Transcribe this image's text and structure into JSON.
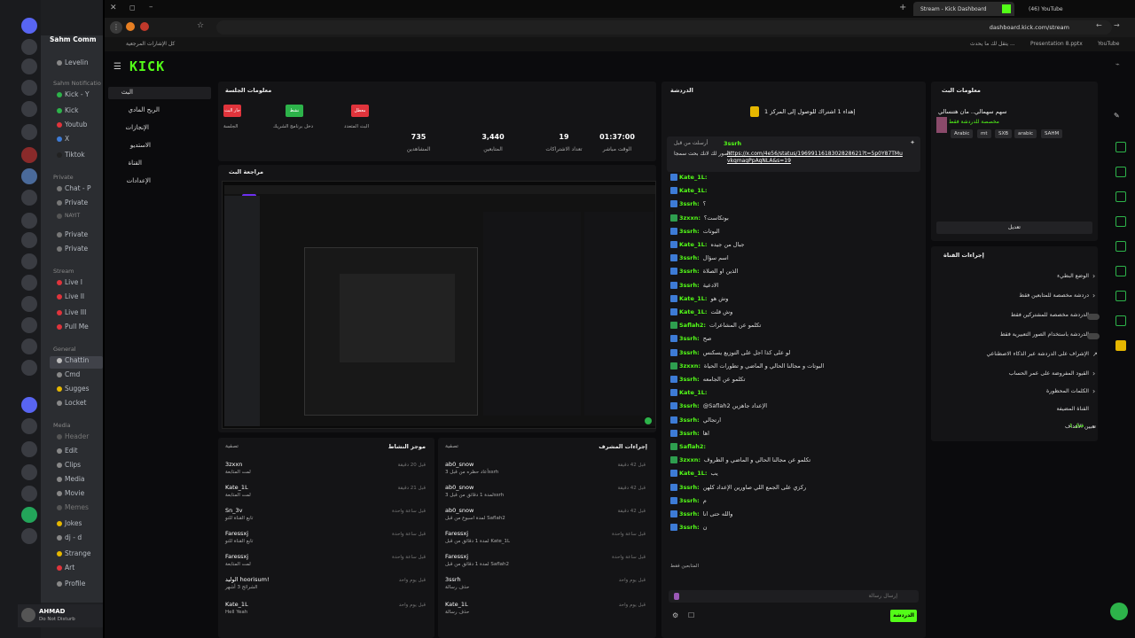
{
  "discord": {
    "server_name": "Sahm Comm",
    "groups": [
      {
        "label": "Sahm Notificatio"
      },
      {
        "label": "Private"
      },
      {
        "label": "Stream"
      },
      {
        "label": "General"
      },
      {
        "label": "Media"
      }
    ],
    "channels": [
      "Levelin",
      "Kick - Y",
      "Kick",
      "Youtub",
      "X",
      "Tiktok",
      "Chat - P",
      "Private",
      "NAYIT",
      "Private",
      "Private",
      "Live I",
      "Live II",
      "Live III",
      "Pull Me",
      "Chattin",
      "Cmd",
      "Sugges",
      "Locket",
      "Header",
      "Edit",
      "Clips",
      "Media",
      "Movie",
      "Memes",
      "Jokes",
      "dj - d",
      "Strange",
      "Art",
      "Profile"
    ],
    "user": {
      "name": "AHMAD",
      "status": "Do Not Disturb"
    }
  },
  "browser": {
    "tabs": [
      {
        "label": "Stream - Kick Dashboard"
      },
      {
        "label": "(46) YouTube"
      }
    ],
    "url": "dashboard.kick.com/stream",
    "bookmarks_left": "كل الإشارات المرجعية",
    "bookmarks_right": [
      "يتقل لك ما يحدث ...",
      "Presentation 8.pptx",
      "YouTube"
    ]
  },
  "kick": {
    "logo": "KICK",
    "nav": [
      "البث",
      "الربح المادي",
      "الإنجازات",
      "الاستديو",
      "القناة",
      "الإعدادات"
    ],
    "session": {
      "title": "معلومات الجلسة",
      "stats": [
        {
          "value": "01:37:00",
          "label": "الوقت مباشر"
        },
        {
          "value": "19",
          "label": "تعداد الاشتراكات"
        },
        {
          "value": "3,440",
          "label": "المتابعين"
        },
        {
          "value": "735",
          "label": "المشاهدين"
        }
      ],
      "badges": [
        {
          "label": "البث المتعدد",
          "text": "معطل",
          "color": "#e0343c"
        },
        {
          "label": "دخل برنامج الشريك",
          "text": "نشط",
          "color": "#2db34a"
        },
        {
          "label": "الجلسة",
          "text": "جار البث",
          "color": "#e0343c"
        }
      ]
    },
    "preview": {
      "title": "مراجعة البث"
    },
    "activity": {
      "title": "موجز النشاط",
      "filter": "تصفية",
      "items": [
        {
          "name": "3zxxn",
          "sub": "لمت المتابعة",
          "time": "قبل 20 دقيقة"
        },
        {
          "name": "Kate_1L",
          "sub": "لمت المتابعة",
          "time": "قبل 21 دقيقة"
        },
        {
          "name": "Sn_3v",
          "sub": "تابع القناة للتو",
          "time": "قبل ساعة واحدة"
        },
        {
          "name": "Faressxj",
          "sub": "تابع القناة للتو",
          "time": "قبل ساعة واحدة"
        },
        {
          "name": "Faressxj",
          "sub": "لمت المتابعة",
          "time": "قبل ساعة واحدة"
        },
        {
          "name": "الوليد hoorisum!",
          "sub": "الشرائح 3 أشهر",
          "time": "قبل يوم واحد"
        },
        {
          "name": "Kate_1L",
          "sub": "Hell Yeah",
          "time": "قبل يوم واحد"
        }
      ]
    },
    "mod": {
      "title": "إجراءات المشرف",
      "filter": "تصفية",
      "items": [
        {
          "name": "ab0_snow",
          "sub": "أعاد حظره من قبل 3ssrh",
          "time": "قبل 42 دقيقة"
        },
        {
          "name": "ab0_snow",
          "sub": "لمدة 1 دقائق من قبل 3ssrh",
          "time": "قبل 42 دقيقة"
        },
        {
          "name": "ab0_snow",
          "sub": "لمدة اسبوع من قبل Saflah2",
          "time": "قبل 42 دقيقة"
        },
        {
          "name": "Faressxj",
          "sub": "لمدة 1 دقائق من قبل Kate_1L",
          "time": "قبل ساعة واحدة"
        },
        {
          "name": "Faressxj",
          "sub": "لمدة 1 دقائق من قبل Saflah2",
          "time": "قبل ساعة واحدة"
        },
        {
          "name": "3ssrh",
          "sub": "حذف رسالة",
          "time": "قبل يوم واحد"
        },
        {
          "name": "Kate_1L",
          "sub": "حذف رسالة",
          "time": "قبل يوم واحد"
        }
      ]
    },
    "chat": {
      "title": "الدردشة",
      "top_banner": "إهداء 1 اشتراك للوصول إلى المركز 1",
      "pinned_user": "3ssrh",
      "pinned_label": "أرسلت من قبل",
      "pinned_text": "اصور لك لانك بحت سمجا",
      "pinned_link": "https://x.com/4e56/status/1969911618302828621?t=5p0Y87TMuvkqmagPpAqNLA&s=19",
      "messages": [
        {
          "user": "Kate_1L:",
          "text": "",
          "tone": "b"
        },
        {
          "user": "Kate_1L:",
          "text": "",
          "tone": "b"
        },
        {
          "user": "3ssrh:",
          "text": "؟",
          "tone": "b"
        },
        {
          "user": "3zxxn:",
          "text": "بوتكاست؟",
          "tone": "g"
        },
        {
          "user": "3ssrh:",
          "text": "البوتات",
          "tone": "b"
        },
        {
          "user": "Kate_1L:",
          "text": "جبال من جيده",
          "tone": "b"
        },
        {
          "user": "3ssrh:",
          "text": "اسم سؤال",
          "tone": "b"
        },
        {
          "user": "3ssrh:",
          "text": "الذين او الصلاة",
          "tone": "b"
        },
        {
          "user": "3ssrh:",
          "text": "الادعية",
          "tone": "b"
        },
        {
          "user": "Kate_1L:",
          "text": "وش هو",
          "tone": "b"
        },
        {
          "user": "Kate_1L:",
          "text": "وش قلت",
          "tone": "b"
        },
        {
          "user": "Saflah2:",
          "text": "تكلمو عن المشاعرات",
          "tone": "g"
        },
        {
          "user": "3ssrh:",
          "text": "صح",
          "tone": "b"
        },
        {
          "user": "3ssrh:",
          "text": "لو على كذا اجل على التوزيع يسكنس",
          "tone": "b"
        },
        {
          "user": "3zxxn:",
          "text": "البوتات و مجالنا الحالي و الماضي و تطورات الحياة",
          "tone": "g"
        },
        {
          "user": "3ssrh:",
          "text": "تكلمو عن الجامعه",
          "tone": "b"
        },
        {
          "user": "Kate_1L:",
          "text": "",
          "tone": "b"
        },
        {
          "user": "3ssrh:",
          "text": "@Saflah2 الإعداد جاهزين",
          "tone": "b"
        },
        {
          "user": "3ssrh:",
          "text": "ارتجالي",
          "tone": "b"
        },
        {
          "user": "3ssrh:",
          "text": "اها",
          "tone": "b"
        },
        {
          "user": "Saflah2:",
          "text": "",
          "tone": "g"
        },
        {
          "user": "3zxxn:",
          "text": "تكلمو عن مجالنا الحالي و الماضي و الظروف",
          "tone": "g"
        },
        {
          "user": "Kate_1L:",
          "text": "يب",
          "tone": "b"
        },
        {
          "user": "3ssrh:",
          "text": "ركزي على الجمع اللي صاورين الإعداد كلهن",
          "tone": "b"
        },
        {
          "user": "3ssrh:",
          "text": "م",
          "tone": "b"
        },
        {
          "user": "3ssrh:",
          "text": "والله حتى انا",
          "tone": "b"
        },
        {
          "user": "3ssrh:",
          "text": "ن",
          "tone": "b"
        }
      ],
      "followers_only": "المتابعين فقط",
      "input_placeholder": "إرسال رسالة",
      "send_label": "الدردشة"
    },
    "stream_info": {
      "title": "معلومات البث",
      "stream_title": "سهم سهمالي.. مان هتنسالي",
      "category": "مخصصة للدردشة فقط",
      "tags": [
        "SAHM",
        "arabic",
        "SXB",
        "mt",
        "Arabic"
      ],
      "edit_label": "تعديل"
    },
    "channel_actions": {
      "title": "إجراءات القناة",
      "items": [
        {
          "label": "الوضع البطيء",
          "control": "chevron"
        },
        {
          "label": "دردشة مخصصة للمتابعين فقط",
          "control": "chevron"
        },
        {
          "label": "الدردشة مخصصة للمشتركين فقط",
          "control": "toggle"
        },
        {
          "label": "الدردشة باستخدام الصور التعبيرية فقط",
          "control": "toggle"
        },
        {
          "label": "الإشراف على الدردشة عبر الذكاء الاصطناعي",
          "control": "ext"
        },
        {
          "label": "القيود المفروضة على عمر الحساب",
          "control": "chevron"
        },
        {
          "label": "الكلمات المحظورة",
          "control": "chevron"
        },
        {
          "label": "القناة المضيفة",
          "control": "none"
        },
        {
          "label": "تعيين الأهداف",
          "control": "chevron",
          "extra": "فعال 1"
        }
      ]
    }
  }
}
